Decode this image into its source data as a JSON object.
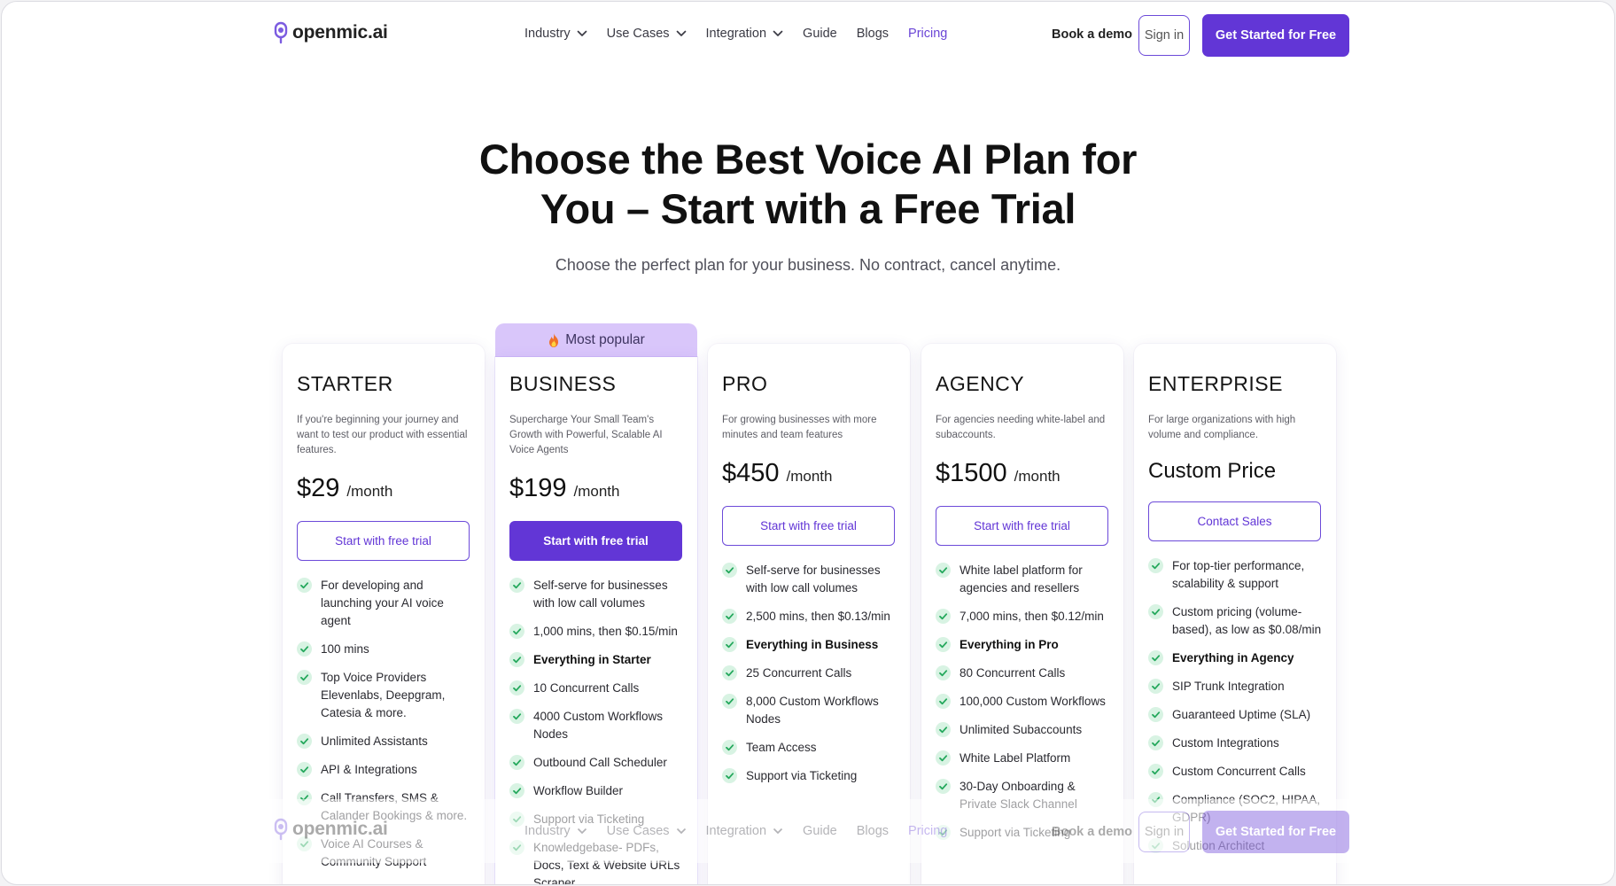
{
  "brand": {
    "name": "openmic.ai",
    "accent": "#6236d6",
    "badge_bg": "#d9c6fa",
    "check_color": "#2db86a"
  },
  "nav": {
    "links": [
      {
        "label": "Industry",
        "has_dropdown": true
      },
      {
        "label": "Use Cases",
        "has_dropdown": true
      },
      {
        "label": "Integration",
        "has_dropdown": true
      },
      {
        "label": "Guide",
        "has_dropdown": false
      },
      {
        "label": "Blogs",
        "has_dropdown": false
      },
      {
        "label": "Pricing",
        "has_dropdown": false
      }
    ],
    "book_demo": "Book a demo",
    "sign_in": "Sign in",
    "cta": "Get Started for Free"
  },
  "hero": {
    "title_line1": "Choose the Best Voice AI Plan for",
    "title_line2": "You – Start with a Free Trial",
    "subtitle": "Choose the perfect plan for your business. No contract, cancel anytime."
  },
  "plans": [
    {
      "name": "STARTER",
      "description": "If you're beginning your journey and want to test our product with essential features.",
      "price": "$29",
      "per": "/month",
      "button": "Start with free trial",
      "features": [
        {
          "text": "For developing and launching your AI voice agent",
          "bold": false
        },
        {
          "text": "100 mins",
          "bold": false
        },
        {
          "text": "Top Voice Providers Elevenlabs, Deepgram, Catesia & more.",
          "bold": false
        },
        {
          "text": "Unlimited Assistants",
          "bold": false
        },
        {
          "text": "API & Integrations",
          "bold": false
        },
        {
          "text": "Call Transfers, SMS & Calander Bookings & more.",
          "bold": false
        },
        {
          "text": "Voice AI Courses & Community Support",
          "bold": false
        }
      ]
    },
    {
      "name": "BUSINESS",
      "badge": "Most popular",
      "description": "Supercharge Your Small Team's Growth with Powerful, Scalable AI Voice Agents",
      "price": "$199",
      "per": "/month",
      "button": "Start with free trial",
      "features": [
        {
          "text": "Self-serve for businesses with low call volumes",
          "bold": false
        },
        {
          "text": "1,000 mins, then $0.15/min",
          "bold": false
        },
        {
          "text": "Everything in Starter",
          "bold": true
        },
        {
          "text": "10 Concurrent Calls",
          "bold": false
        },
        {
          "text": "4000 Custom Workflows Nodes",
          "bold": false
        },
        {
          "text": "Outbound Call Scheduler",
          "bold": false
        },
        {
          "text": "Workflow Builder",
          "bold": false
        },
        {
          "text": "Support via Ticketing",
          "bold": false
        },
        {
          "text": "Knowledgebase- PDFs, Docs, Text & Website URLs Scraper.",
          "bold": false
        }
      ]
    },
    {
      "name": "PRO",
      "description": "For growing businesses with more minutes and team features",
      "price": "$450",
      "per": "/month",
      "button": "Start with free trial",
      "features": [
        {
          "text": "Self-serve for businesses with low call volumes",
          "bold": false
        },
        {
          "text": "2,500 mins, then $0.13/min",
          "bold": false
        },
        {
          "text": "Everything in Business",
          "bold": true
        },
        {
          "text": "25 Concurrent Calls",
          "bold": false
        },
        {
          "text": "8,000 Custom Workflows Nodes",
          "bold": false
        },
        {
          "text": "Team Access",
          "bold": false
        },
        {
          "text": "Support via Ticketing",
          "bold": false
        }
      ]
    },
    {
      "name": "AGENCY",
      "description": "For agencies needing white-label and subaccounts.",
      "price": "$1500",
      "per": "/month",
      "button": "Start with free trial",
      "features": [
        {
          "text": "White label platform for agencies and resellers",
          "bold": false
        },
        {
          "text": "7,000 mins, then $0.12/min",
          "bold": false
        },
        {
          "text": "Everything in Pro",
          "bold": true
        },
        {
          "text": "80 Concurrent Calls",
          "bold": false
        },
        {
          "text": "100,000 Custom Workflows",
          "bold": false
        },
        {
          "text": "Unlimited Subaccounts",
          "bold": false
        },
        {
          "text": "White Label Platform",
          "bold": false
        },
        {
          "text": "30-Day Onboarding & Private Slack Channel",
          "bold": false
        },
        {
          "text": "Support via Ticketing",
          "bold": false
        }
      ]
    },
    {
      "name": "ENTERPRISE",
      "description": "For large organizations with high volume and compliance.",
      "custom_price": "Custom Price",
      "button": "Contact Sales",
      "features": [
        {
          "text": "For top-tier performance, scalability & support",
          "bold": false
        },
        {
          "text": "Custom pricing (volume-based), as low as $0.08/min",
          "bold": false
        },
        {
          "text": "Everything in Agency",
          "bold": true
        },
        {
          "text": "SIP Trunk Integration",
          "bold": false
        },
        {
          "text": "Guaranteed Uptime (SLA)",
          "bold": false
        },
        {
          "text": "Custom Integrations",
          "bold": false
        },
        {
          "text": "Custom Concurrent Calls",
          "bold": false
        },
        {
          "text": "Compliance (SOC2, HIPAA, GDPR)",
          "bold": false
        },
        {
          "text": "Solution Architect",
          "bold": false
        }
      ]
    }
  ]
}
